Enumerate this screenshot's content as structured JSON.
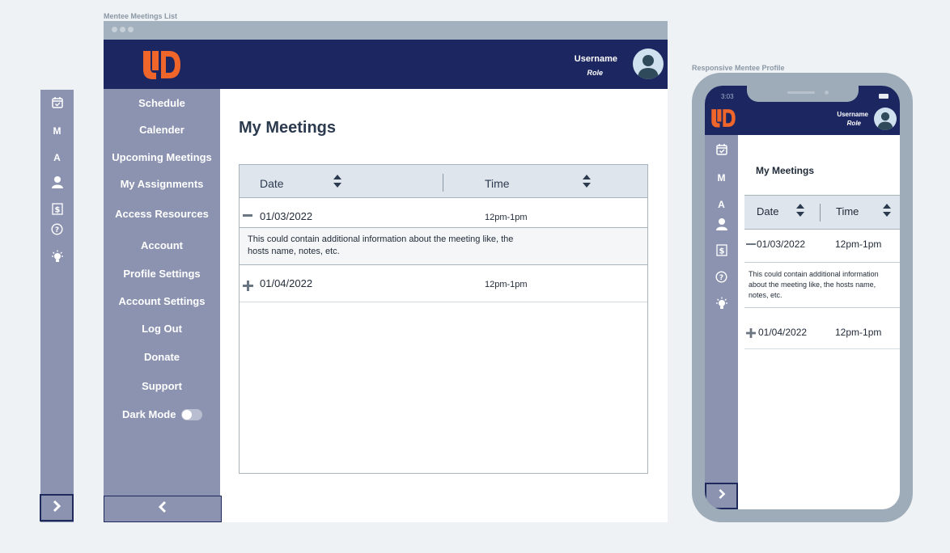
{
  "labels": {
    "desktop_frame": "Mentee Meetings List",
    "mobile_frame": "Responsive Mentee Profile"
  },
  "collapsed_sidebar": {
    "items": [
      {
        "icon": "calendar-check-icon"
      },
      {
        "text": "M"
      },
      {
        "text": "A"
      },
      {
        "icon": "user-icon"
      },
      {
        "icon": "dollar-icon"
      },
      {
        "icon": "help-icon"
      },
      {
        "icon": "lightbulb-icon"
      }
    ],
    "expand_icon": "chevron-right-icon"
  },
  "header": {
    "logo": "UD logo",
    "username": "Username",
    "role": "Role"
  },
  "sidebar": {
    "items": [
      {
        "label": "Schedule"
      },
      {
        "label": "Calender"
      },
      {
        "label": "Upcoming Meetings"
      },
      {
        "label": "My Assignments"
      },
      {
        "label": "Access Resources"
      },
      {
        "label": "Account"
      },
      {
        "label": "Profile Settings"
      },
      {
        "label": "Account Settings"
      },
      {
        "label": "Log Out"
      },
      {
        "label": "Donate"
      },
      {
        "label": "Support"
      }
    ],
    "dark_mode_label": "Dark Mode",
    "dark_mode_on": false,
    "collapse_icon": "chevron-left-icon"
  },
  "main": {
    "title": "My Meetings",
    "columns": [
      "Date",
      "Time"
    ],
    "meetings": [
      {
        "date": "01/03/2022",
        "time": "12pm-1pm",
        "expanded": true,
        "details": "This could contain additional information about the meeting like, the hosts name, notes, etc."
      },
      {
        "date": "01/04/2022",
        "time": "12pm-1pm",
        "expanded": false
      }
    ]
  },
  "mobile": {
    "status_time": "3:03",
    "username": "Username",
    "role": "Role",
    "title": "My Meetings",
    "columns": [
      "Date",
      "Time"
    ],
    "meetings": [
      {
        "date": "01/03/2022",
        "time": "12pm-1pm",
        "details": "This could contain additional information about the meeting like, the hosts name, notes, etc."
      },
      {
        "date": "01/04/2022",
        "time": "12pm-1pm"
      }
    ]
  },
  "colors": {
    "navy": "#1c2761",
    "sidebar": "#8b93b0",
    "accent_orange": "#f0652a",
    "table_header": "#dfe5ed"
  }
}
